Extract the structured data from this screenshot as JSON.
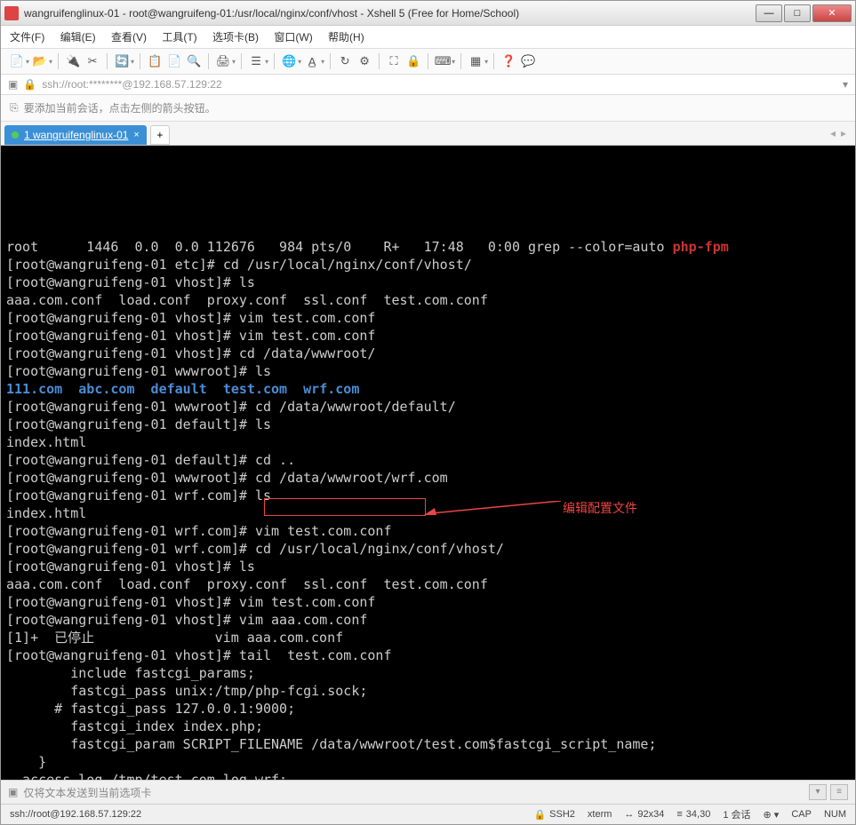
{
  "titlebar": {
    "text": "wangruifenglinux-01 - root@wangruifeng-01:/usr/local/nginx/conf/vhost - Xshell 5 (Free for Home/School)"
  },
  "menu": {
    "file": "文件(F)",
    "edit": "编辑(E)",
    "view": "查看(V)",
    "tools": "工具(T)",
    "tabs": "选项卡(B)",
    "window": "窗口(W)",
    "help": "帮助(H)"
  },
  "addressbar": {
    "text": "ssh://root:********@192.168.57.129:22"
  },
  "infobar": {
    "text": "要添加当前会话，点击左侧的箭头按钮。"
  },
  "tab": {
    "label": "1 wangruifenglinux-01"
  },
  "terminal_lines": [
    {
      "segs": [
        {
          "t": "root      1446  0.0  0.0 112676   984 pts/0    R+   17:48   0:00 grep --color=auto "
        },
        {
          "t": "php-fpm",
          "c": "red"
        }
      ]
    },
    {
      "segs": [
        {
          "t": "[root@wangruifeng-01 etc]# cd /usr/local/nginx/conf/vhost/"
        }
      ]
    },
    {
      "segs": [
        {
          "t": "[root@wangruifeng-01 vhost]# ls"
        }
      ]
    },
    {
      "segs": [
        {
          "t": "aaa.com.conf  load.conf  proxy.conf  ssl.conf  test.com.conf"
        }
      ]
    },
    {
      "segs": [
        {
          "t": "[root@wangruifeng-01 vhost]# vim test.com.conf"
        }
      ]
    },
    {
      "segs": [
        {
          "t": "[root@wangruifeng-01 vhost]# vim test.com.conf"
        }
      ]
    },
    {
      "segs": [
        {
          "t": "[root@wangruifeng-01 vhost]# cd /data/wwwroot/"
        }
      ]
    },
    {
      "segs": [
        {
          "t": "[root@wangruifeng-01 wwwroot]# ls"
        }
      ]
    },
    {
      "segs": [
        {
          "t": "111.com  abc.com  default  test.com  wrf.com",
          "c": "blue"
        }
      ]
    },
    {
      "segs": [
        {
          "t": "[root@wangruifeng-01 wwwroot]# cd /data/wwwroot/default/"
        }
      ]
    },
    {
      "segs": [
        {
          "t": "[root@wangruifeng-01 default]# ls"
        }
      ]
    },
    {
      "segs": [
        {
          "t": "index.html"
        }
      ]
    },
    {
      "segs": [
        {
          "t": "[root@wangruifeng-01 default]# cd .."
        }
      ]
    },
    {
      "segs": [
        {
          "t": "[root@wangruifeng-01 wwwroot]# cd /data/wwwroot/wrf.com"
        }
      ]
    },
    {
      "segs": [
        {
          "t": "[root@wangruifeng-01 wrf.com]# ls"
        }
      ]
    },
    {
      "segs": [
        {
          "t": "index.html"
        }
      ]
    },
    {
      "segs": [
        {
          "t": "[root@wangruifeng-01 wrf.com]# vim test.com.conf"
        }
      ]
    },
    {
      "segs": [
        {
          "t": "[root@wangruifeng-01 wrf.com]# cd /usr/local/nginx/conf/vhost/"
        }
      ]
    },
    {
      "segs": [
        {
          "t": "[root@wangruifeng-01 vhost]# ls"
        }
      ]
    },
    {
      "segs": [
        {
          "t": "aaa.com.conf  load.conf  proxy.conf  ssl.conf  test.com.conf"
        }
      ]
    },
    {
      "segs": [
        {
          "t": "[root@wangruifeng-01 vhost]# vim test.com.conf"
        }
      ]
    },
    {
      "segs": [
        {
          "t": "[root@wangruifeng-01 vhost]# vim aaa.com.conf"
        }
      ]
    },
    {
      "segs": [
        {
          "t": ""
        }
      ]
    },
    {
      "segs": [
        {
          "t": "[1]+  已停止               vim aaa.com.conf"
        }
      ]
    },
    {
      "segs": [
        {
          "t": "[root@wangruifeng-01 vhost]# tail  test.com.conf"
        }
      ]
    },
    {
      "segs": [
        {
          "t": "        include fastcgi_params;"
        }
      ]
    },
    {
      "segs": [
        {
          "t": "        fastcgi_pass unix:/tmp/php-fcgi.sock;"
        }
      ]
    },
    {
      "segs": [
        {
          "t": "      # fastcgi_pass 127.0.0.1:9000;"
        }
      ]
    },
    {
      "segs": [
        {
          "t": "        fastcgi_index index.php;"
        }
      ]
    },
    {
      "segs": [
        {
          "t": "        fastcgi_param SCRIPT_FILENAME /data/wwwroot/test.com$fastcgi_script_name;"
        }
      ]
    },
    {
      "segs": [
        {
          "t": "    }"
        }
      ]
    },
    {
      "segs": [
        {
          "t": ""
        }
      ]
    },
    {
      "segs": [
        {
          "t": "  access_log /tmp/test.com.log wrf;"
        }
      ]
    }
  ],
  "annotation": {
    "text": "编辑配置文件"
  },
  "sendbar": {
    "text": "仅将文本发送到当前选项卡"
  },
  "statusbar": {
    "conn": "ssh://root@192.168.57.129:22",
    "ssh": "SSH2",
    "term": "xterm",
    "size": "92x34",
    "pos": "34,30",
    "sessions": "1 会话",
    "cap": "CAP",
    "num": "NUM"
  }
}
